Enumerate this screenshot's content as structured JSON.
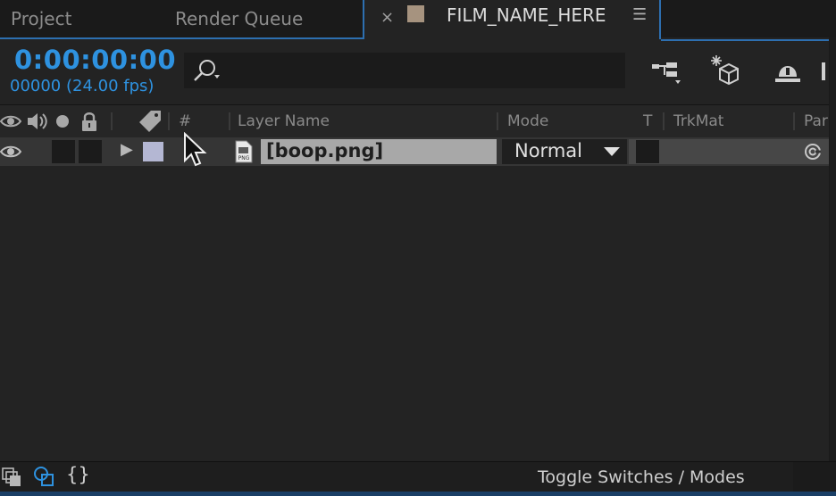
{
  "tabs": {
    "project": "Project",
    "render_queue": "Render Queue",
    "comp": {
      "close": "×",
      "title": "FILM_NAME_HERE",
      "menu": "☰",
      "swatch_color": "#a6937f"
    }
  },
  "header": {
    "timecode": "0:00:00:00",
    "frames": "00000 (24.00 fps)",
    "search_placeholder": ""
  },
  "columns": {
    "number": "#",
    "layer_name": "Layer Name",
    "mode": "Mode",
    "t": "T",
    "trkmat": "TrkMat",
    "parent": "Par"
  },
  "layer": {
    "name": "[boop.png]",
    "file_icon_text": "PNG",
    "mode": "Normal",
    "label_color": "#b4b7d3",
    "expand_glyph": "▶"
  },
  "footer": {
    "toggle_label": "Toggle Switches / Modes",
    "braces": "{}"
  },
  "colors": {
    "accent": "#2e92e0",
    "tab_highlight": "#2d6fb0",
    "background": "#232323"
  }
}
